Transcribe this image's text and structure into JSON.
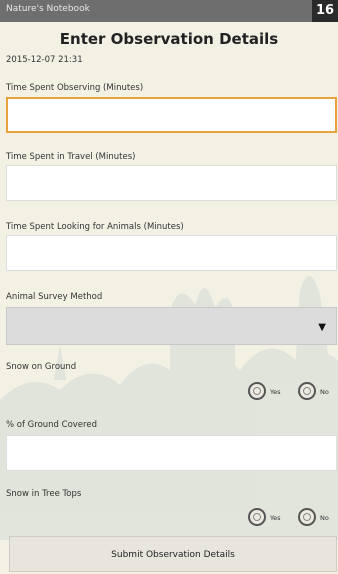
{
  "status_bar": {
    "app_name": "Nature's Notebook",
    "badge": "16"
  },
  "form": {
    "title": "Enter Observation Details",
    "timestamp": "2015-12-07 21:31",
    "fields": {
      "time_observing": {
        "label": "Time Spent Observing (Minutes)",
        "value": ""
      },
      "time_travel": {
        "label": "Time Spent in Travel (Minutes)",
        "value": ""
      },
      "time_animals": {
        "label": "Time Spent Looking for Animals (Minutes)",
        "value": ""
      },
      "survey_method": {
        "label": "Animal Survey Method",
        "selected": ""
      },
      "snow_ground": {
        "label": "Snow on Ground",
        "yes": "Yes",
        "no": "No"
      },
      "ground_covered": {
        "label": "% of Ground Covered",
        "value": ""
      },
      "snow_trees": {
        "label": "Snow in Tree Tops",
        "yes": "Yes",
        "no": "No"
      }
    },
    "submit_label": "Submit Observation Details"
  },
  "colors": {
    "focus_border": "#e8a33d",
    "background": "#f3f0e4",
    "status_bar": "#6e6e6e"
  },
  "icons": {
    "select_caret": "caret-down-icon"
  }
}
